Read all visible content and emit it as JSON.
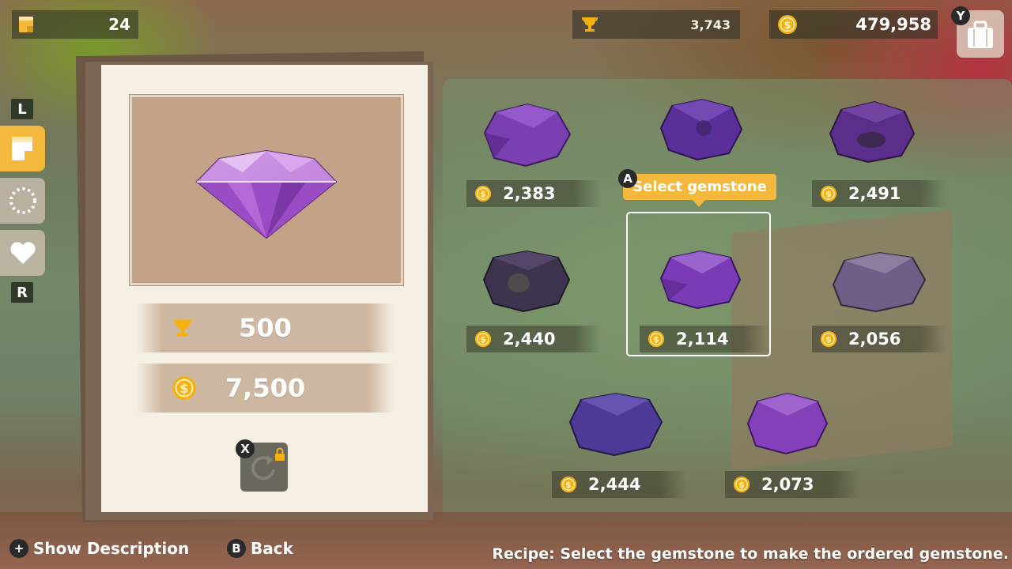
{
  "hud": {
    "notes_count": "24",
    "trophies": "3,743",
    "coins": "479,958",
    "bag_button_key": "Y"
  },
  "tabs": {
    "prev_key": "L",
    "next_key": "R",
    "items": [
      {
        "icon": "notepad-icon",
        "active": true
      },
      {
        "icon": "ring-icon",
        "active": false
      },
      {
        "icon": "heart-icon",
        "active": false
      }
    ]
  },
  "order_card": {
    "gem_icon": "amethyst-cut-gem",
    "trophy_reward": "500",
    "coin_reward": "7,500",
    "locked_action_key": "X"
  },
  "gems": [
    {
      "price": "2,383",
      "shade": "#7a3fb0"
    },
    {
      "price": "2,491",
      "shade": "#5a2e8a"
    },
    {
      "price": "2,440",
      "shade": "#3e3450"
    },
    {
      "price": "2,114",
      "shade": "#7c3bb6",
      "selected": true
    },
    {
      "price": "2,056",
      "shade": "#6e5f86"
    },
    {
      "price": "2,444",
      "shade": "#4e3a96"
    },
    {
      "price": "2,073",
      "shade": "#8440b8"
    },
    {
      "price": "",
      "shade": "#5c35a6"
    }
  ],
  "tooltip": {
    "key": "A",
    "text": "Select gemstone"
  },
  "prompts": {
    "show_description_key": "+",
    "show_description": "Show Description",
    "back_key": "B",
    "back": "Back"
  },
  "recipe_text": "Recipe: Select the gemstone to make the ordered gemstone.",
  "colors": {
    "accent": "#f4b93c",
    "card_bg": "#f6efe4",
    "coin": "#f5b10f"
  }
}
